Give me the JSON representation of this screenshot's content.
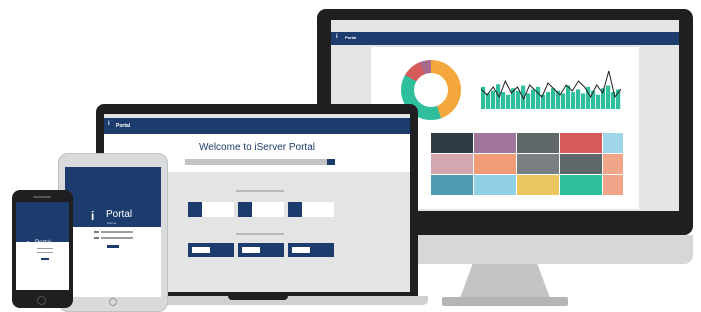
{
  "brand": {
    "logo_glyph": "i",
    "app_name": "Portal",
    "tablet_subtitle": "iServer"
  },
  "laptop": {
    "welcome_text": "Welcome to iServer Portal"
  },
  "monitor": {
    "header_title": "Portal",
    "donut_colors": [
      "#f3a73d",
      "#2fbf9d",
      "#d65a5a",
      "#a86a8c"
    ],
    "tile_colors": [
      [
        "#2f3b45",
        "#a0769a",
        "#5f6769",
        "#d65a5a",
        "#9fd6e8"
      ],
      [
        "#d3a6b0",
        "#f29b77",
        "#7a7f81",
        "#5f6769",
        "#f3a58a"
      ],
      [
        "#4f9cb1",
        "#8fd0e4",
        "#ecc75f",
        "#2fbf9d",
        "#f3a58a"
      ]
    ],
    "bar_heights": [
      0.85,
      0.6,
      0.7,
      0.95,
      0.65,
      0.55,
      0.8,
      0.7,
      0.9,
      0.6,
      0.75,
      0.85,
      0.55,
      0.65,
      0.8,
      0.7,
      0.6,
      0.9,
      0.65,
      0.75,
      0.6,
      0.85,
      0.7,
      0.55,
      0.8,
      0.9,
      0.65,
      0.75
    ],
    "line_levels": [
      0.5,
      0.35,
      0.55,
      0.3,
      0.7,
      0.4,
      0.55,
      0.25,
      0.6,
      0.45,
      0.3,
      0.65,
      0.5,
      0.35,
      0.6,
      0.45,
      0.7,
      0.55,
      0.3,
      0.6,
      0.4,
      0.95,
      0.3,
      0.5
    ]
  }
}
